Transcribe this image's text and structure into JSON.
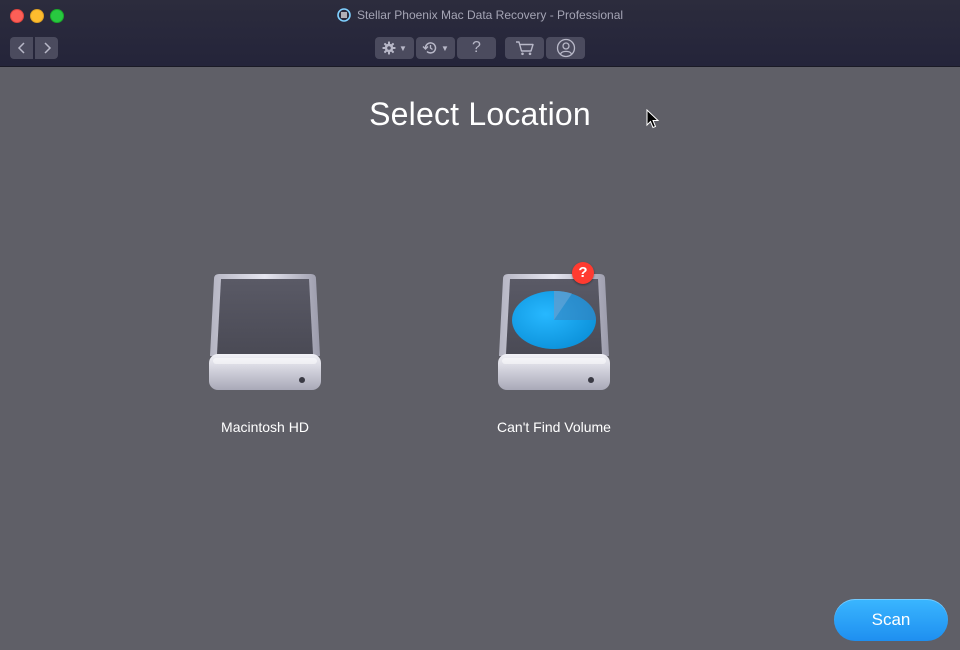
{
  "window": {
    "title": "Stellar Phoenix Mac Data Recovery - Professional",
    "traffic_lights": [
      "close",
      "minimize",
      "maximize"
    ]
  },
  "toolbar": {
    "back_icon": "chevron-left-icon",
    "forward_icon": "chevron-right-icon",
    "settings_icon": "gear-icon",
    "history_icon": "history-icon",
    "help_label": "?",
    "cart_icon": "cart-icon",
    "account_icon": "user-icon"
  },
  "main": {
    "heading": "Select Location",
    "drives": [
      {
        "label": "Macintosh HD",
        "icon": "hard-drive-icon"
      },
      {
        "label": "Can't Find Volume",
        "icon": "hard-drive-pie-icon",
        "badge": "?"
      }
    ]
  },
  "actions": {
    "scan_label": "Scan"
  },
  "colors": {
    "background": "#5f5f67",
    "titlebar": "#2a2a3c",
    "accent": "#2aa3f8",
    "badge": "#ff3b30"
  }
}
